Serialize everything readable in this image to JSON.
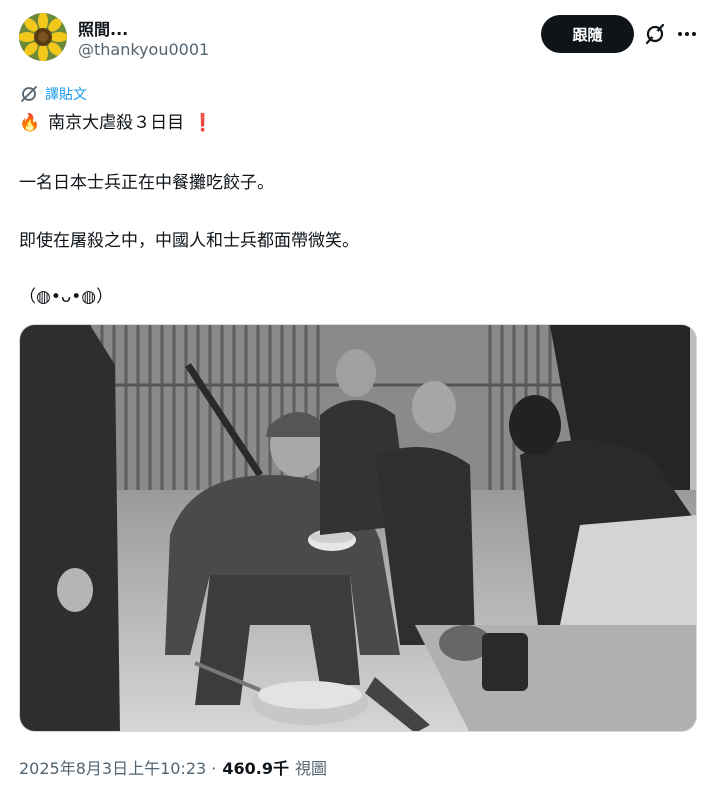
{
  "author": {
    "display_name": "照間...",
    "handle": "@thankyou0001",
    "avatar_icon": "sunflower-avatar"
  },
  "header": {
    "follow_label": "跟隨",
    "grok_icon": "grok-icon",
    "more_icon": "more-icon"
  },
  "translate": {
    "label": "譯貼文",
    "icon": "translate-icon"
  },
  "post": {
    "line1_emoji_left": "🔥",
    "line1_text": "南京大虐殺３日目",
    "line1_emoji_right": "❗",
    "line2": "一名日本士兵正在中餐攤吃餃子。",
    "line3": "即使在屠殺之中，中國人和士兵都面帶微笑。",
    "line4": "（◍•ᴗ•◍）"
  },
  "media": {
    "type": "black-and-white photograph"
  },
  "meta": {
    "timestamp": "2025年8月3日上午10:23 ·",
    "views_count": "460.9千",
    "views_label": "視圖"
  },
  "colors": {
    "accent": "#1d9bf0",
    "text_primary": "#0f1419",
    "text_secondary": "#536471",
    "button_bg": "#0f1419",
    "alert_red": "#e0245e"
  }
}
